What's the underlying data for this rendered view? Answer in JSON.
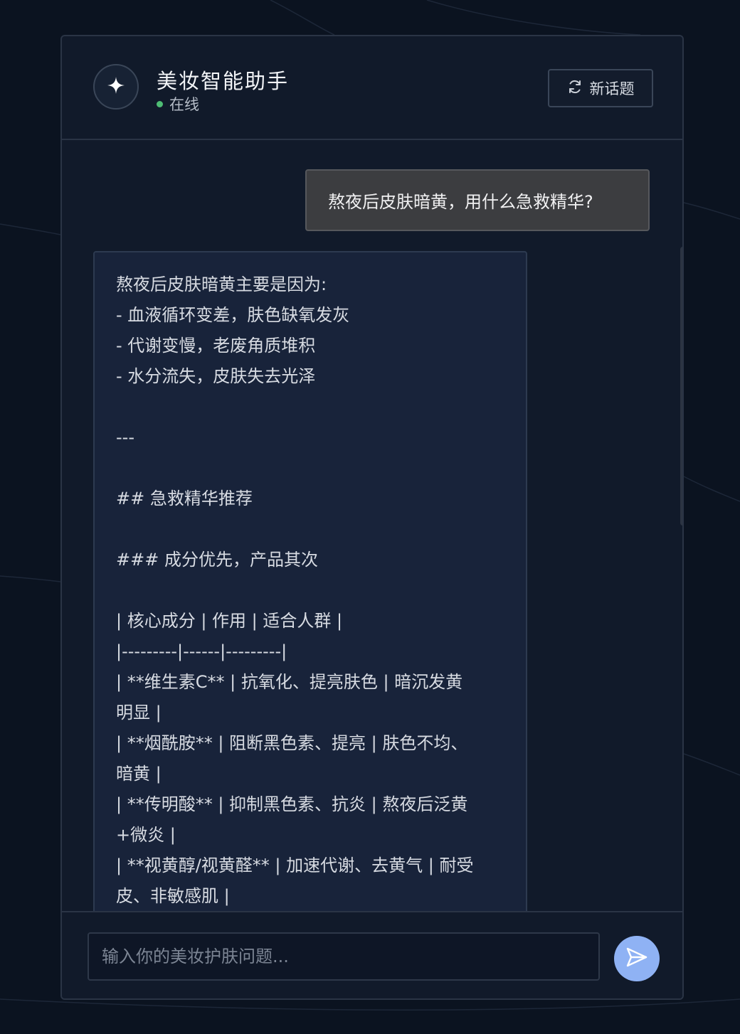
{
  "header": {
    "title": "美妆智能助手",
    "status": "在线",
    "new_topic_label": "新话题",
    "avatar_icon": "sparkle-icon",
    "refresh_icon": "refresh-icon"
  },
  "messages": {
    "user": "熬夜后皮肤暗黄，用什么急救精华?",
    "assistant_lines": [
      "熬夜后皮肤暗黄主要是因为:",
      "- 血液循环变差，肤色缺氧发灰",
      "- 代谢变慢，老废角质堆积",
      "- 水分流失，皮肤失去光泽",
      "",
      "---",
      "",
      "## 急救精华推荐",
      "",
      "### 成分优先，产品其次",
      "",
      "| 核心成分 | 作用 | 适合人群 |",
      "|---------|------|---------|",
      "| **维生素C** | 抗氧化、提亮肤色 | 暗沉发黄",
      "明显 |",
      "| **烟酰胺** | 阻断黑色素、提亮 | 肤色不均、",
      "暗黄 |",
      "| **传明酸** | 抑制黑色素、抗炎 | 熬夜后泛黄",
      "+微炎 |",
      "| **视黄醇/视黄醛** | 加速代谢、去黄气 | 耐受",
      "皮、非敏感肌 |"
    ]
  },
  "composer": {
    "placeholder": "输入你的美妆护肤问题...",
    "send_icon": "send-icon"
  },
  "colors": {
    "background": "#0b1320",
    "panel": "#111a2a",
    "user_bubble": "#3c3d40",
    "assistant_bubble": "#18233a",
    "online": "#4ebd74",
    "send_button": "#8fb2f4"
  }
}
